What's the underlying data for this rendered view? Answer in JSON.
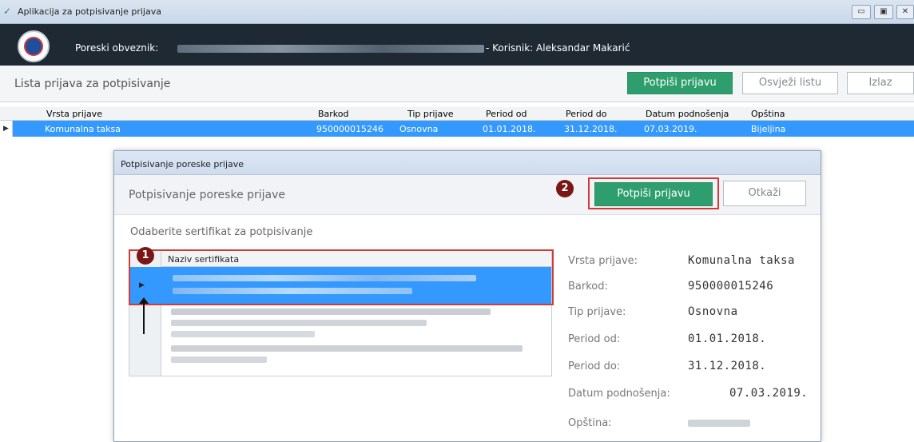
{
  "window": {
    "title": "Aplikacija za potpisivanje prijava",
    "buttons": [
      "▭",
      "▣",
      "✕"
    ]
  },
  "header": {
    "taxpayer_label": "Poreski obveznik:",
    "user_text": "- Korisnik: Aleksandar Makarić"
  },
  "toolbar": {
    "list_title": "Lista prijava za potpisivanje",
    "sign_button": "Potpiši prijavu",
    "refresh_button": "Osvježi listu",
    "exit_button": "Izlaz"
  },
  "grid": {
    "columns": [
      "Vrsta prijave",
      "Barkod",
      "Tip prijave",
      "Period od",
      "Period do",
      "Datum podnošenja",
      "Opština"
    ],
    "rows": [
      [
        "Komunalna taksa",
        "950000015246",
        "Osnovna",
        "01.01.2018.",
        "31.12.2018.",
        "07.03.2019.",
        "Bijeljina"
      ]
    ]
  },
  "dialog": {
    "window_title": "Potpisivanje poreske prijave",
    "heading": "Potpisivanje poreske prijave",
    "sign_button": "Potpiši prijavu",
    "cancel_button": "Otkaži",
    "section_label": "Odaberite sertifikat za potpisivanje",
    "cert_column": "Naziv sertifikata",
    "badge1": "1",
    "badge2": "2",
    "details": [
      {
        "label": "Vrsta prijave:",
        "value": "Komunalna taksa"
      },
      {
        "label": "Barkod:",
        "value": "950000015246"
      },
      {
        "label": "Tip prijave:",
        "value": "Osnovna"
      },
      {
        "label": "Period od:",
        "value": "01.01.2018."
      },
      {
        "label": "Period do:",
        "value": "31.12.2018."
      },
      {
        "label": "Datum podnošenja:",
        "value": "07.03.2019."
      },
      {
        "label": "Opština:",
        "value": ""
      }
    ]
  },
  "colors": {
    "accent_green": "#2f9e6e",
    "selection_blue": "#3399ff",
    "highlight_red": "#d23a3a",
    "badge_dark_red": "#7a1616",
    "header_dark": "#1e2933"
  }
}
